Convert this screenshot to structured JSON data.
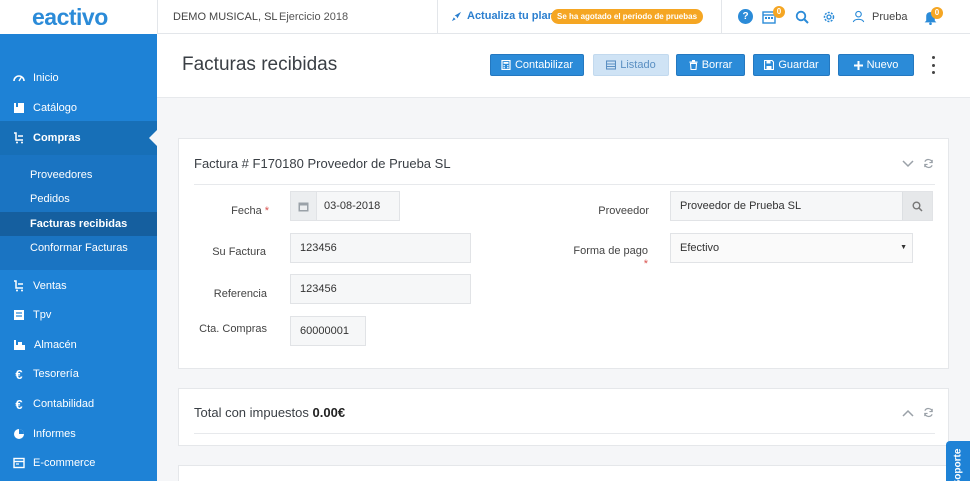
{
  "app": {
    "logo_text": "eactivo"
  },
  "topbar": {
    "company": "DEMO MUSICAL, SL",
    "exercise": "Ejercicio 2018",
    "upgrade_label": "Actualiza tu plan",
    "trial_badge": "Se ha agotado el periodo de pruebas",
    "calendar_count": "0",
    "notifications_count": "0",
    "user_name": "Prueba",
    "icons": [
      "help-icon",
      "calendar-icon",
      "search-icon",
      "gear-icon",
      "user-icon",
      "bell-icon"
    ]
  },
  "sidebar": {
    "items": [
      {
        "label": "Inicio",
        "icon": "dashboard-icon"
      },
      {
        "label": "Catálogo",
        "icon": "catalog-icon"
      },
      {
        "label": "Compras",
        "icon": "cart-icon"
      },
      {
        "label": "Ventas",
        "icon": "sales-icon"
      },
      {
        "label": "Tpv",
        "icon": "pos-icon"
      },
      {
        "label": "Almacén",
        "icon": "warehouse-icon"
      },
      {
        "label": "Tesorería",
        "icon": "euro-icon"
      },
      {
        "label": "Contabilidad",
        "icon": "euro-icon"
      },
      {
        "label": "Informes",
        "icon": "pie-chart-icon"
      },
      {
        "label": "E-commerce",
        "icon": "ecommerce-icon"
      }
    ],
    "active_item": "Compras",
    "subitems": [
      {
        "label": "Proveedores"
      },
      {
        "label": "Pedidos"
      },
      {
        "label": "Facturas recibidas"
      },
      {
        "label": "Conformar Facturas"
      }
    ],
    "active_subitem": "Facturas recibidas"
  },
  "header": {
    "title": "Facturas recibidas",
    "buttons": {
      "contabilizar": "Contabilizar",
      "listado": "Listado",
      "borrar": "Borrar",
      "guardar": "Guardar",
      "nuevo": "Nuevo"
    }
  },
  "invoice_card": {
    "title": "Factura # F170180 Proveedor de Prueba SL",
    "fields": {
      "fecha_label": "Fecha",
      "fecha_value": "03-08-2018",
      "su_factura_label": "Su Factura",
      "su_factura_value": "123456",
      "referencia_label": "Referencia",
      "referencia_value": "123456",
      "cta_compras_label": "Cta. Compras",
      "cta_compras_value": "60000001",
      "proveedor_label": "Proveedor",
      "proveedor_value": "Proveedor de Prueba SL",
      "forma_pago_label": "Forma de pago",
      "forma_pago_value": "Efectivo"
    },
    "required_mark": "*"
  },
  "totals_card": {
    "label": "Total con impuestos",
    "value": "0.00€"
  },
  "support_tab": {
    "label": "Soporte"
  },
  "colors": {
    "primary": "#2b8bd8",
    "sidebar": "#1e82d6",
    "badge": "#f5a623",
    "required": "#d9534f"
  }
}
